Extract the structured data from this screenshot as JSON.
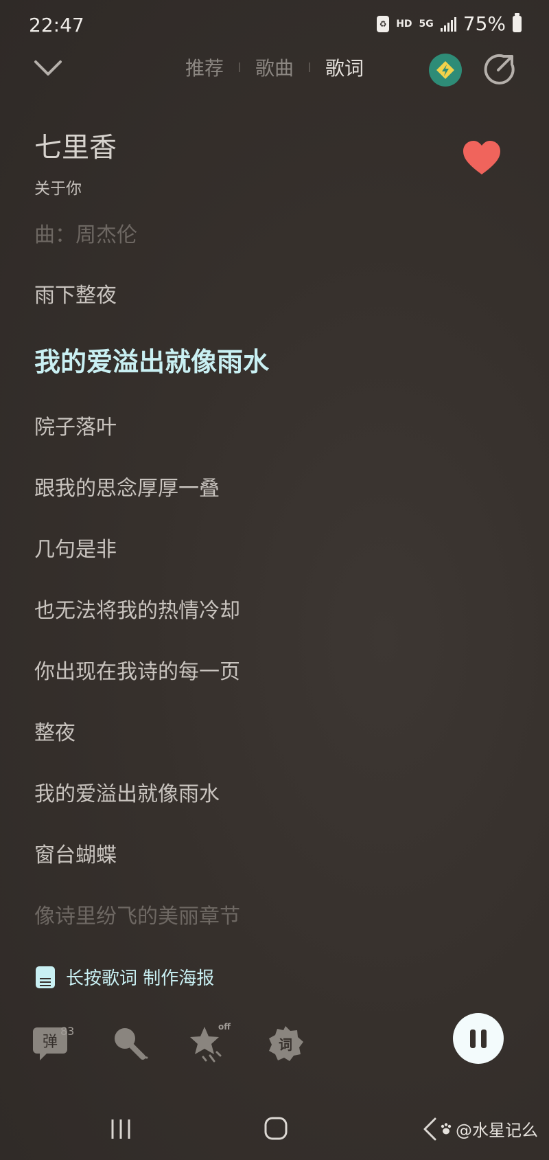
{
  "status_bar": {
    "time": "22:47",
    "hd": "HD",
    "network": "5G",
    "battery": "75%"
  },
  "tabs": [
    {
      "label": "推荐",
      "active": false
    },
    {
      "label": "歌曲",
      "active": false
    },
    {
      "label": "歌词",
      "active": true
    }
  ],
  "song": {
    "title": "七里香",
    "album": "关于你",
    "liked": true
  },
  "lyrics": [
    {
      "text": "曲：周杰伦",
      "state": "faded"
    },
    {
      "text": "雨下整夜",
      "state": "normal"
    },
    {
      "text": "我的爱溢出就像雨水",
      "state": "current"
    },
    {
      "text": "院子落叶",
      "state": "normal"
    },
    {
      "text": "跟我的思念厚厚一叠",
      "state": "normal"
    },
    {
      "text": "几句是非",
      "state": "normal"
    },
    {
      "text": "也无法将我的热情冷却",
      "state": "normal"
    },
    {
      "text": "你出现在我诗的每一页",
      "state": "normal"
    },
    {
      "text": "整夜",
      "state": "normal"
    },
    {
      "text": "我的爱溢出就像雨水",
      "state": "normal"
    },
    {
      "text": "窗台蝴蝶",
      "state": "normal"
    },
    {
      "text": "像诗里纷飞的美丽章节",
      "state": "faded"
    }
  ],
  "poster_hint": "长按歌词 制作海报",
  "toolbar": {
    "danmu_label": "弹",
    "danmu_count": "83",
    "effect_state": "off",
    "lyric_label": "词"
  },
  "colors": {
    "accent": "#c9f0f3",
    "like": "#f0645c",
    "boost": "#2e8c77"
  },
  "watermark": "@水星记么"
}
